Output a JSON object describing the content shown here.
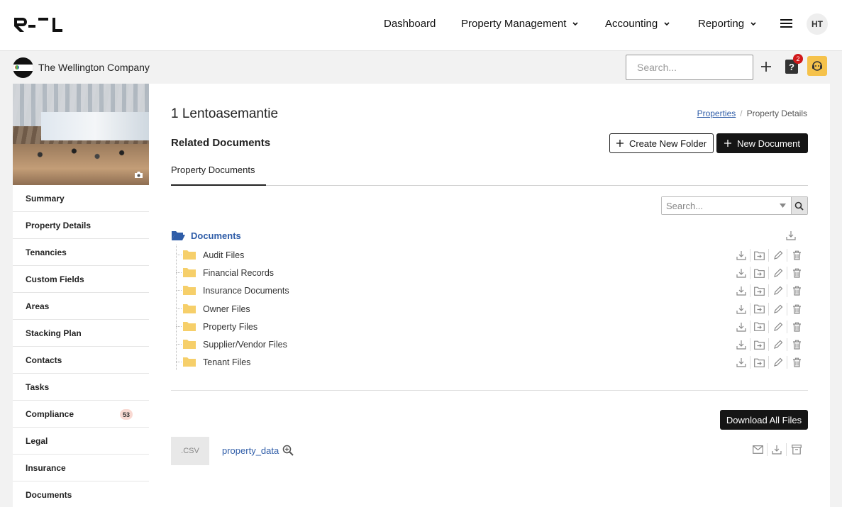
{
  "nav": {
    "logo_text": "R--L",
    "items": [
      {
        "label": "Dashboard",
        "has_dropdown": false
      },
      {
        "label": "Property Management",
        "has_dropdown": true
      },
      {
        "label": "Accounting",
        "has_dropdown": true
      },
      {
        "label": "Reporting",
        "has_dropdown": true
      }
    ],
    "avatar_initials": "HT"
  },
  "subbar": {
    "company_name": "The Wellington Company",
    "search_placeholder": "Search...",
    "help_label": "?",
    "help_badge": "2",
    "support_color": "#f5c24b"
  },
  "sidebar": {
    "items": [
      {
        "label": "Summary"
      },
      {
        "label": "Property Details"
      },
      {
        "label": "Tenancies"
      },
      {
        "label": "Custom Fields"
      },
      {
        "label": "Areas"
      },
      {
        "label": "Stacking Plan"
      },
      {
        "label": "Contacts"
      },
      {
        "label": "Tasks"
      },
      {
        "label": "Compliance",
        "badge": "53"
      },
      {
        "label": "Legal"
      },
      {
        "label": "Insurance"
      },
      {
        "label": "Documents"
      }
    ]
  },
  "main": {
    "title": "1 Lentoasemantie",
    "breadcrumb": {
      "link": "Properties",
      "separator": "/",
      "current": "Property Details"
    },
    "section_title": "Related Documents",
    "create_folder_label": "Create New Folder",
    "new_document_label": "New Document",
    "tab_label": "Property Documents",
    "doc_search_placeholder": "Search...",
    "tree": {
      "root_label": "Documents",
      "folders": [
        {
          "label": "Audit Files"
        },
        {
          "label": "Financial Records"
        },
        {
          "label": "Insurance Documents"
        },
        {
          "label": "Owner Files"
        },
        {
          "label": "Property Files"
        },
        {
          "label": "Supplier/Vendor Files"
        },
        {
          "label": "Tenant Files"
        }
      ]
    },
    "download_all_label": "Download All Files",
    "file": {
      "extension": ".CSV",
      "name": "property_data"
    }
  },
  "colors": {
    "link": "#2f5da8",
    "folder": "#f6cf6a",
    "dark_button": "#151515",
    "badge_red": "#d0181a",
    "compliance_badge": "#f9d9d2"
  }
}
